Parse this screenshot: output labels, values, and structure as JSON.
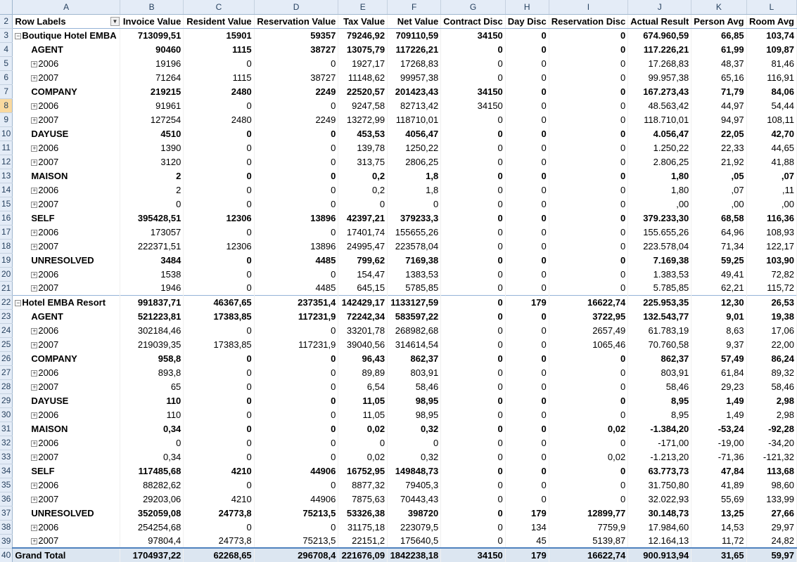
{
  "columns": [
    "A",
    "B",
    "C",
    "D",
    "E",
    "F",
    "G",
    "H",
    "I",
    "J",
    "K",
    "L"
  ],
  "headers": {
    "row_num": "2",
    "labels": [
      "Row Labels",
      "Invoice Value",
      "Resident Value",
      "Reservation Value",
      "Tax Value",
      "Net Value",
      "Contract Disc",
      "Day Disc",
      "Reservation Disc",
      "Actual Result",
      "Person Avg",
      "Room Avg"
    ],
    "filter_icon": "dropdown-arrow-icon"
  },
  "selected_row": "8",
  "rows": [
    {
      "n": "3",
      "type": "hotel",
      "label": "Boutique Hotel EMBA",
      "v": [
        "713099,51",
        "15901",
        "59357",
        "79246,92",
        "709110,59",
        "34150",
        "0",
        "0",
        "674.960,59",
        "66,85",
        "103,74"
      ]
    },
    {
      "n": "4",
      "type": "seg",
      "label": "AGENT",
      "v": [
        "90460",
        "1115",
        "38727",
        "13075,79",
        "117226,21",
        "0",
        "0",
        "0",
        "117.226,21",
        "61,99",
        "109,87"
      ]
    },
    {
      "n": "5",
      "type": "year",
      "label": "2006",
      "v": [
        "19196",
        "0",
        "0",
        "1927,17",
        "17268,83",
        "0",
        "0",
        "0",
        "17.268,83",
        "48,37",
        "81,46"
      ]
    },
    {
      "n": "6",
      "type": "year",
      "label": "2007",
      "v": [
        "71264",
        "1115",
        "38727",
        "11148,62",
        "99957,38",
        "0",
        "0",
        "0",
        "99.957,38",
        "65,16",
        "116,91"
      ]
    },
    {
      "n": "7",
      "type": "seg",
      "label": "COMPANY",
      "v": [
        "219215",
        "2480",
        "2249",
        "22520,57",
        "201423,43",
        "34150",
        "0",
        "0",
        "167.273,43",
        "71,79",
        "84,06"
      ]
    },
    {
      "n": "8",
      "type": "year",
      "label": "2006",
      "v": [
        "91961",
        "0",
        "0",
        "9247,58",
        "82713,42",
        "34150",
        "0",
        "0",
        "48.563,42",
        "44,97",
        "54,44"
      ]
    },
    {
      "n": "9",
      "type": "year",
      "label": "2007",
      "v": [
        "127254",
        "2480",
        "2249",
        "13272,99",
        "118710,01",
        "0",
        "0",
        "0",
        "118.710,01",
        "94,97",
        "108,11"
      ]
    },
    {
      "n": "10",
      "type": "seg",
      "label": "DAYUSE",
      "v": [
        "4510",
        "0",
        "0",
        "453,53",
        "4056,47",
        "0",
        "0",
        "0",
        "4.056,47",
        "22,05",
        "42,70"
      ]
    },
    {
      "n": "11",
      "type": "year",
      "label": "2006",
      "v": [
        "1390",
        "0",
        "0",
        "139,78",
        "1250,22",
        "0",
        "0",
        "0",
        "1.250,22",
        "22,33",
        "44,65"
      ]
    },
    {
      "n": "12",
      "type": "year",
      "label": "2007",
      "v": [
        "3120",
        "0",
        "0",
        "313,75",
        "2806,25",
        "0",
        "0",
        "0",
        "2.806,25",
        "21,92",
        "41,88"
      ]
    },
    {
      "n": "13",
      "type": "seg",
      "label": "MAISON",
      "v": [
        "2",
        "0",
        "0",
        "0,2",
        "1,8",
        "0",
        "0",
        "0",
        "1,80",
        ",05",
        ",07"
      ]
    },
    {
      "n": "14",
      "type": "year",
      "label": "2006",
      "v": [
        "2",
        "0",
        "0",
        "0,2",
        "1,8",
        "0",
        "0",
        "0",
        "1,80",
        ",07",
        ",11"
      ]
    },
    {
      "n": "15",
      "type": "year",
      "label": "2007",
      "v": [
        "0",
        "0",
        "0",
        "0",
        "0",
        "0",
        "0",
        "0",
        ",00",
        ",00",
        ",00"
      ]
    },
    {
      "n": "16",
      "type": "seg",
      "label": "SELF",
      "v": [
        "395428,51",
        "12306",
        "13896",
        "42397,21",
        "379233,3",
        "0",
        "0",
        "0",
        "379.233,30",
        "68,58",
        "116,36"
      ]
    },
    {
      "n": "17",
      "type": "year",
      "label": "2006",
      "v": [
        "173057",
        "0",
        "0",
        "17401,74",
        "155655,26",
        "0",
        "0",
        "0",
        "155.655,26",
        "64,96",
        "108,93"
      ]
    },
    {
      "n": "18",
      "type": "year",
      "label": "2007",
      "v": [
        "222371,51",
        "12306",
        "13896",
        "24995,47",
        "223578,04",
        "0",
        "0",
        "0",
        "223.578,04",
        "71,34",
        "122,17"
      ]
    },
    {
      "n": "19",
      "type": "seg",
      "label": "UNRESOLVED",
      "v": [
        "3484",
        "0",
        "4485",
        "799,62",
        "7169,38",
        "0",
        "0",
        "0",
        "7.169,38",
        "59,25",
        "103,90"
      ]
    },
    {
      "n": "20",
      "type": "year",
      "label": "2006",
      "v": [
        "1538",
        "0",
        "0",
        "154,47",
        "1383,53",
        "0",
        "0",
        "0",
        "1.383,53",
        "49,41",
        "72,82"
      ]
    },
    {
      "n": "21",
      "type": "year",
      "label": "2007",
      "v": [
        "1946",
        "0",
        "4485",
        "645,15",
        "5785,85",
        "0",
        "0",
        "0",
        "5.785,85",
        "62,21",
        "115,72"
      ]
    },
    {
      "n": "22",
      "type": "hotel",
      "label": "Hotel EMBA Resort",
      "v": [
        "991837,71",
        "46367,65",
        "237351,4",
        "142429,17",
        "1133127,59",
        "0",
        "179",
        "16622,74",
        "225.953,35",
        "12,30",
        "26,53"
      ]
    },
    {
      "n": "23",
      "type": "seg",
      "label": "AGENT",
      "v": [
        "521223,81",
        "17383,85",
        "117231,9",
        "72242,34",
        "583597,22",
        "0",
        "0",
        "3722,95",
        "132.543,77",
        "9,01",
        "19,38"
      ]
    },
    {
      "n": "24",
      "type": "year",
      "label": "2006",
      "v": [
        "302184,46",
        "0",
        "0",
        "33201,78",
        "268982,68",
        "0",
        "0",
        "2657,49",
        "61.783,19",
        "8,63",
        "17,06"
      ]
    },
    {
      "n": "25",
      "type": "year",
      "label": "2007",
      "v": [
        "219039,35",
        "17383,85",
        "117231,9",
        "39040,56",
        "314614,54",
        "0",
        "0",
        "1065,46",
        "70.760,58",
        "9,37",
        "22,00"
      ]
    },
    {
      "n": "26",
      "type": "seg",
      "label": "COMPANY",
      "v": [
        "958,8",
        "0",
        "0",
        "96,43",
        "862,37",
        "0",
        "0",
        "0",
        "862,37",
        "57,49",
        "86,24"
      ]
    },
    {
      "n": "27",
      "type": "year",
      "label": "2006",
      "v": [
        "893,8",
        "0",
        "0",
        "89,89",
        "803,91",
        "0",
        "0",
        "0",
        "803,91",
        "61,84",
        "89,32"
      ]
    },
    {
      "n": "28",
      "type": "year",
      "label": "2007",
      "v": [
        "65",
        "0",
        "0",
        "6,54",
        "58,46",
        "0",
        "0",
        "0",
        "58,46",
        "29,23",
        "58,46"
      ]
    },
    {
      "n": "29",
      "type": "seg",
      "label": "DAYUSE",
      "v": [
        "110",
        "0",
        "0",
        "11,05",
        "98,95",
        "0",
        "0",
        "0",
        "8,95",
        "1,49",
        "2,98"
      ]
    },
    {
      "n": "30",
      "type": "year",
      "label": "2006",
      "v": [
        "110",
        "0",
        "0",
        "11,05",
        "98,95",
        "0",
        "0",
        "0",
        "8,95",
        "1,49",
        "2,98"
      ]
    },
    {
      "n": "31",
      "type": "seg",
      "label": "MAISON",
      "v": [
        "0,34",
        "0",
        "0",
        "0,02",
        "0,32",
        "0",
        "0",
        "0,02",
        "-1.384,20",
        "-53,24",
        "-92,28"
      ]
    },
    {
      "n": "32",
      "type": "year",
      "label": "2006",
      "v": [
        "0",
        "0",
        "0",
        "0",
        "0",
        "0",
        "0",
        "0",
        "-171,00",
        "-19,00",
        "-34,20"
      ]
    },
    {
      "n": "33",
      "type": "year",
      "label": "2007",
      "v": [
        "0,34",
        "0",
        "0",
        "0,02",
        "0,32",
        "0",
        "0",
        "0,02",
        "-1.213,20",
        "-71,36",
        "-121,32"
      ]
    },
    {
      "n": "34",
      "type": "seg",
      "label": "SELF",
      "v": [
        "117485,68",
        "4210",
        "44906",
        "16752,95",
        "149848,73",
        "0",
        "0",
        "0",
        "63.773,73",
        "47,84",
        "113,68"
      ]
    },
    {
      "n": "35",
      "type": "year",
      "label": "2006",
      "v": [
        "88282,62",
        "0",
        "0",
        "8877,32",
        "79405,3",
        "0",
        "0",
        "0",
        "31.750,80",
        "41,89",
        "98,60"
      ]
    },
    {
      "n": "36",
      "type": "year",
      "label": "2007",
      "v": [
        "29203,06",
        "4210",
        "44906",
        "7875,63",
        "70443,43",
        "0",
        "0",
        "0",
        "32.022,93",
        "55,69",
        "133,99"
      ]
    },
    {
      "n": "37",
      "type": "seg",
      "label": "UNRESOLVED",
      "v": [
        "352059,08",
        "24773,8",
        "75213,5",
        "53326,38",
        "398720",
        "0",
        "179",
        "12899,77",
        "30.148,73",
        "13,25",
        "27,66"
      ]
    },
    {
      "n": "38",
      "type": "year",
      "label": "2006",
      "v": [
        "254254,68",
        "0",
        "0",
        "31175,18",
        "223079,5",
        "0",
        "134",
        "7759,9",
        "17.984,60",
        "14,53",
        "29,97"
      ]
    },
    {
      "n": "39",
      "type": "year",
      "label": "2007",
      "v": [
        "97804,4",
        "24773,8",
        "75213,5",
        "22151,2",
        "175640,5",
        "0",
        "45",
        "5139,87",
        "12.164,13",
        "11,72",
        "24,82"
      ]
    },
    {
      "n": "40",
      "type": "total",
      "label": "Grand Total",
      "v": [
        "1704937,22",
        "62268,65",
        "296708,4",
        "221676,09",
        "1842238,18",
        "34150",
        "179",
        "16622,74",
        "900.913,94",
        "31,65",
        "59,97"
      ]
    }
  ]
}
